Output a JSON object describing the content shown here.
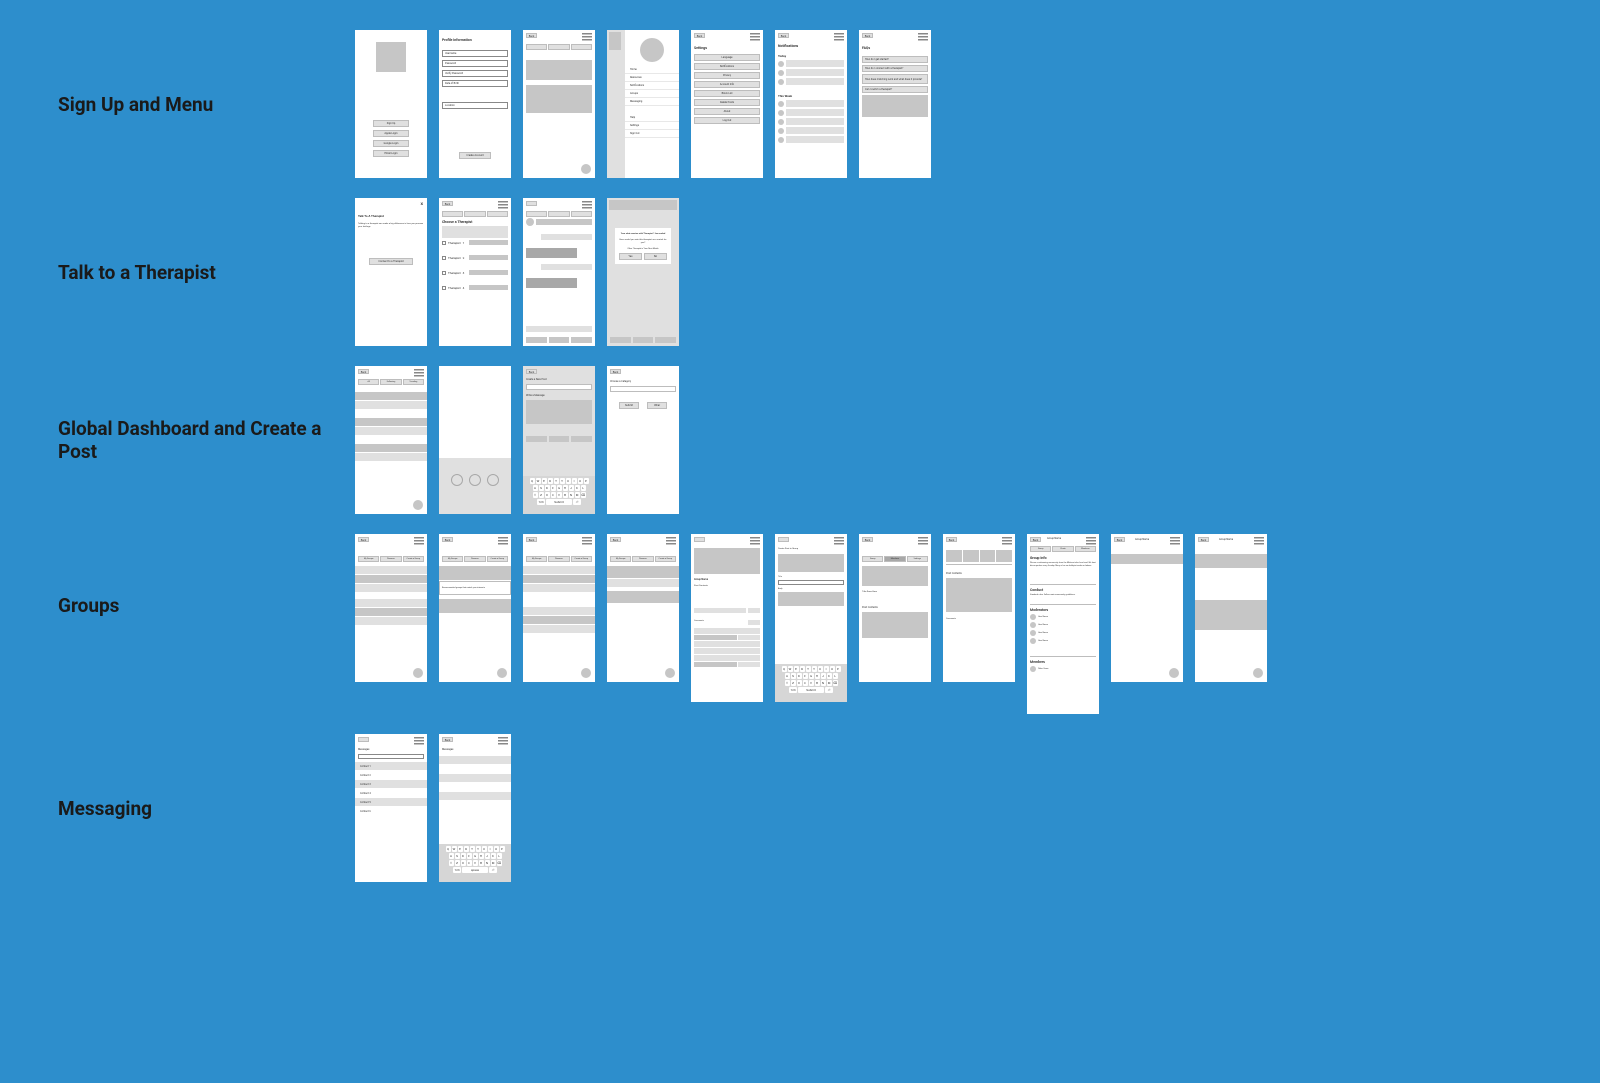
{
  "sections": {
    "signup": "Sign Up  and Menu",
    "therapist": "Talk to a Therapist",
    "dashboard": "Global Dashboard and Create a Post",
    "groups": "Groups",
    "messaging": "Messaging"
  },
  "row1": {
    "s1": {
      "b1": "Sign Up",
      "b2": "Apple Login",
      "b3": "Google Login",
      "b4": "Email Login"
    },
    "s2": {
      "title": "Profile Information",
      "f1": "Username",
      "f2": "Password",
      "f3": "Verify Password",
      "f4": "Date of Birth",
      "f5": "Location",
      "submit": "Create Account"
    },
    "s3": {
      "back": "Back"
    },
    "s4": {
      "nav1": "Home",
      "nav2": "Resources",
      "nav3": "Notifications",
      "nav4": "Groups",
      "nav5": "Messaging",
      "nav6": "Help",
      "nav7": "Settings",
      "nav8": "Sign Out"
    },
    "s5": {
      "title": "Settings",
      "back": "Back",
      "rows": [
        "Language",
        "Notifications",
        "Privacy",
        "Account Info",
        "Block List",
        "Delete Posts",
        "About",
        "Log Out"
      ]
    },
    "s6": {
      "title": "Notifications",
      "back": "Back",
      "today": "Today",
      "week": "This Week"
    },
    "s7": {
      "title": "FAQs",
      "back": "Back",
      "q1": "How do I get started?",
      "q2": "How do I connect with a therapist?",
      "q3": "How does matching work and what does it provide?",
      "q4": "Can I switch a therapist?"
    }
  },
  "row2": {
    "s1": {
      "close": "X",
      "title": "Talk To A Therapist",
      "body": "Talking to a therapist can make a big difference in how you process your feelings.",
      "btn": "Connect to a Therapist"
    },
    "s2": {
      "back": "Back",
      "title": "Choose a Therapist",
      "sort": "Sort",
      "therapistPrefix": "Therapist"
    },
    "s3": {
      "back": "Back",
      "chat": "Type a Message..."
    },
    "s4": {
      "modalTitle": "Your chat session with Therapist 1 has ended",
      "modalBody": "How would you rate this therapist as a match for you?",
      "btnY": "Yes",
      "btnN": "No"
    }
  },
  "row3": {
    "s1": {
      "back": "Back",
      "tabs": [
        "All",
        "Following",
        "Trending"
      ]
    },
    "s3": {
      "back": "Back",
      "title": "Create a New Post",
      "field": "Write a Message",
      "submit": "Submit"
    },
    "s4": {
      "back": "Back",
      "title": "Choose a Category",
      "btn1": "Submit",
      "btn2": "Other"
    }
  },
  "row4": {
    "generic": {
      "back": "Back",
      "tabs": [
        "My Groups",
        "Discover",
        "Create a Group"
      ]
    },
    "s5": {
      "title": "Group Name",
      "desc": "Description",
      "posts": "Post Contents"
    },
    "s6": {
      "title": "Create Post in Group",
      "submit": "Submit"
    },
    "s7": {
      "back": "Back",
      "tabs": [
        "Group",
        "Members",
        "Settings"
      ],
      "posts": "Post Contents"
    },
    "s8": {
      "back": "Back",
      "posts": "Post Contents",
      "comments": "Comments"
    },
    "s9": {
      "back": "Back",
      "tab1": "Group",
      "tab2": "Posts",
      "tab3": "Members",
      "title": "Group Info",
      "desc": "We are a welcoming community from the Midwest who love food. We host dinner parties every Sunday. Many of us are hobbyist cooks or bakers.",
      "conduct": "Conduct",
      "conductBody": "Standard rules. Follow main community guidelines.",
      "mods": "Moderators",
      "members": "Members"
    },
    "s10": {
      "back": "Back",
      "title": "Group Name"
    },
    "s11": {
      "back": "Back",
      "title": "Group Name"
    }
  },
  "row5": {
    "s1": {
      "title": "Messages",
      "search": "Search",
      "names": [
        "Contact 1",
        "Contact 2",
        "Contact 3",
        "Contact 4",
        "Contact 5",
        "Contact 6"
      ]
    },
    "s2": {
      "back": "Back",
      "title": "Messages"
    }
  },
  "keys": {
    "r1": [
      "Q",
      "W",
      "E",
      "R",
      "T",
      "Y",
      "U",
      "I",
      "O",
      "P"
    ],
    "r2": [
      "A",
      "S",
      "D",
      "F",
      "G",
      "H",
      "J",
      "K",
      "L"
    ],
    "r3": [
      "Z",
      "X",
      "C",
      "V",
      "B",
      "N",
      "M"
    ],
    "space": "space",
    "submit": "Submit"
  }
}
